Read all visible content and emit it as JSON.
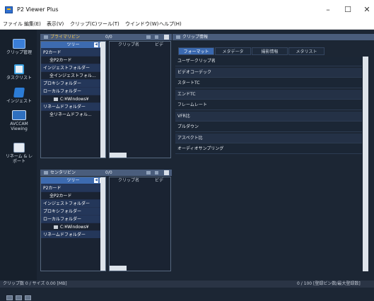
{
  "window": {
    "title": "P2 Viewer Plus",
    "minimize": "–",
    "maximize": "☐",
    "close": "✕"
  },
  "menu": [
    "ファイル",
    "編集(E)",
    "表示(V)",
    "クリップ(C)",
    "ツール(T)",
    "ウインドウ(W)",
    "ヘルプ(H)"
  ],
  "leftbar": [
    {
      "label": "クリップ管理",
      "icon": "clip-management-icon",
      "color": "#3a7ed8"
    },
    {
      "label": "タスクリスト",
      "icon": "task-list-icon",
      "color": "#4aa0e0"
    },
    {
      "label": "インジェスト",
      "icon": "ingest-icon",
      "color": "#2c7cd6"
    },
    {
      "label": "AVCCAM Viewing",
      "icon": "avccam-icon",
      "color": "#2e6fbf"
    },
    {
      "label": "リネーム & レポート",
      "icon": "rename-report-icon",
      "color": "#5a6f94"
    }
  ],
  "primary": {
    "title": "プライマリビン",
    "count": "0/0",
    "tree_label": "ツリー",
    "items": [
      {
        "text": "P2カード",
        "level": "hd"
      },
      {
        "text": "全P2カード",
        "level": "sub"
      },
      {
        "text": "インジェストフォルダー",
        "level": "hd"
      },
      {
        "text": "全インジェストフォル...",
        "level": "sub"
      },
      {
        "text": "プロキシフォルダー",
        "level": "hd"
      },
      {
        "text": "ローカルフォルダー",
        "level": "hd"
      },
      {
        "text": "C:¥Windows¥",
        "level": "sub2"
      },
      {
        "text": "リネームドフォルダー",
        "level": "hd"
      },
      {
        "text": "全リネームドフォル...",
        "level": "sub"
      }
    ],
    "clip_col": "クリップ名",
    "clip_col2": "ビデ"
  },
  "center": {
    "title": "センタリビン",
    "count": "0/0",
    "tree_label": "ツリー",
    "items": [
      {
        "text": "P2カード",
        "level": "hd"
      },
      {
        "text": "全P2カード",
        "level": "sub"
      },
      {
        "text": "インジェストフォルダー",
        "level": "hd"
      },
      {
        "text": "プロキシフォルダー",
        "level": "hd"
      },
      {
        "text": "ローカルフォルダー",
        "level": "hd"
      },
      {
        "text": "C:¥Windows¥",
        "level": "sub2"
      },
      {
        "text": "リネームドフォルダー",
        "level": "hd"
      }
    ],
    "clip_col": "クリップ名",
    "clip_col2": "ビデ"
  },
  "clipinfo": {
    "title": "クリップ情報",
    "tabs": [
      "フォーマット",
      "メタデータ",
      "撮影情報",
      "メタリスト"
    ],
    "rows": [
      "ユーザークリップ名",
      "ビデオコーデック",
      "スタートTC",
      "エンドTC",
      "フレームレート",
      "VFR比",
      "プルダウン",
      "アスペクト比",
      "オーディオサンプリング"
    ]
  },
  "status": {
    "left": "クリップ数 0 / サイズ 0.00 [MB]",
    "right": "0 / 100 [登録ビン数/最大登録数]"
  }
}
